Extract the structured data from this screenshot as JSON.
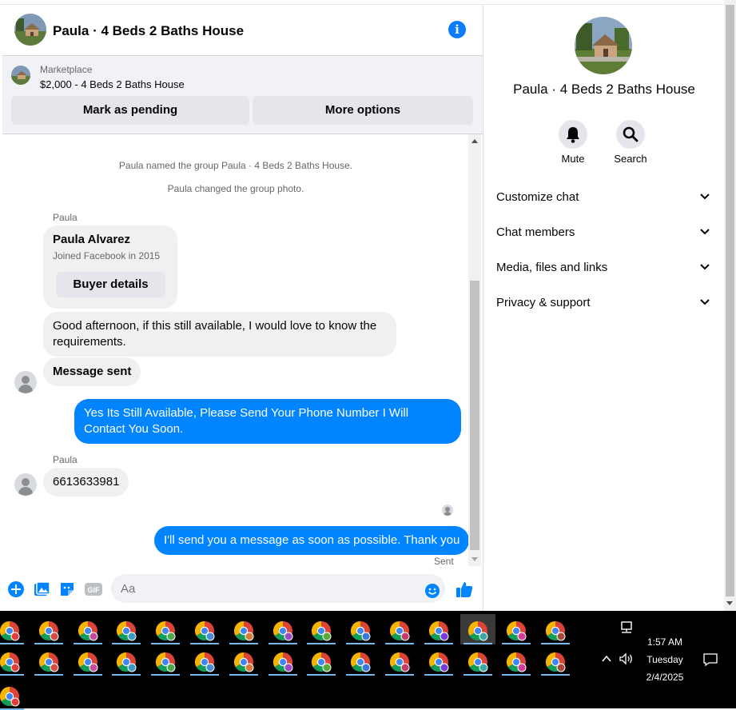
{
  "chat": {
    "title": "Paula · 4 Beds 2 Baths House",
    "info_icon": "info-icon",
    "marketplace": {
      "label": "Marketplace",
      "listing": "$2,000 - 4 Beds 2 Baths House",
      "mark_pending": "Mark as pending",
      "more_options": "More options"
    },
    "system_messages": [
      "Paula named the group Paula · 4 Beds 2 Baths House.",
      "Paula changed the group photo."
    ],
    "sender_name": "Paula",
    "buyer_card": {
      "name": "Paula Alvarez",
      "joined": "Joined Facebook in 2015",
      "button": "Buyer details"
    },
    "messages": [
      {
        "from": "Paula",
        "text": "Good afternoon, if this still available, I would love to know the requirements."
      },
      {
        "from": "Paula",
        "text": "Message sent"
      },
      {
        "from": "me",
        "text": "Yes Its Still Available, Please Send Your Phone Number I Will Contact You Soon."
      },
      {
        "from": "Paula",
        "text": "6613633981"
      },
      {
        "from": "me",
        "text": "I'll send you a message as soon as possible. Thank you"
      }
    ],
    "sent_status": "Sent",
    "composer": {
      "placeholder": "Aa",
      "gif_label": "GIF"
    }
  },
  "panel": {
    "title": "Paula · 4 Beds 2 Baths House",
    "actions": [
      {
        "label": "Mute",
        "icon": "bell-icon"
      },
      {
        "label": "Search",
        "icon": "search-icon"
      }
    ],
    "sections": [
      "Customize chat",
      "Chat members",
      "Media, files and links",
      "Privacy & support"
    ]
  },
  "taskbar": {
    "time": "1:57 AM",
    "day": "Tuesday",
    "date": "2/4/2025",
    "app_icon": "chrome-icon"
  },
  "colors": {
    "accent": "#0084ff",
    "info": "#0a7cff",
    "received_bubble": "#f0f0f0",
    "taskbar": "#000000"
  }
}
